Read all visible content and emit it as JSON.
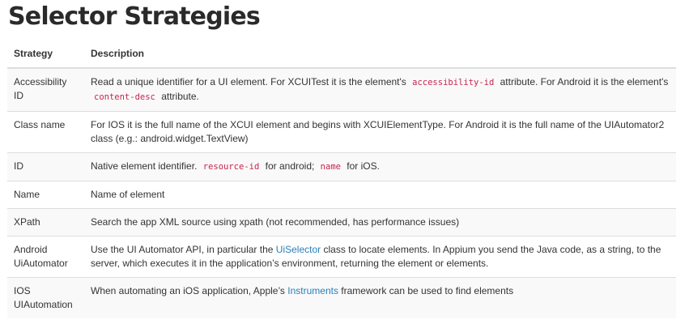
{
  "title": "Selector Strategies",
  "headers": {
    "strategy": "Strategy",
    "description": "Description"
  },
  "rows": [
    {
      "strategy": "Accessibility ID",
      "parts": [
        {
          "t": "text",
          "v": "Read a unique identifier for a UI element. For XCUITest it is the element's "
        },
        {
          "t": "code",
          "v": "accessibility-id"
        },
        {
          "t": "text",
          "v": " attribute. For Android it is the element's "
        },
        {
          "t": "code",
          "v": "content-desc"
        },
        {
          "t": "text",
          "v": " attribute."
        }
      ]
    },
    {
      "strategy": "Class name",
      "parts": [
        {
          "t": "text",
          "v": "For IOS it is the full name of the XCUI element and begins with XCUIElementType. For Android it is the full name of the UIAutomator2 class (e.g.: android.widget.TextView)"
        }
      ]
    },
    {
      "strategy": "ID",
      "parts": [
        {
          "t": "text",
          "v": "Native element identifier. "
        },
        {
          "t": "code",
          "v": "resource-id"
        },
        {
          "t": "text",
          "v": " for android; "
        },
        {
          "t": "code",
          "v": "name"
        },
        {
          "t": "text",
          "v": " for iOS."
        }
      ]
    },
    {
      "strategy": "Name",
      "parts": [
        {
          "t": "text",
          "v": "Name of element"
        }
      ]
    },
    {
      "strategy": "XPath",
      "parts": [
        {
          "t": "text",
          "v": "Search the app XML source using xpath (not recommended, has performance issues)"
        }
      ]
    },
    {
      "strategy": "Android UiAutomator",
      "parts": [
        {
          "t": "text",
          "v": "Use the UI Automator API, in particular the "
        },
        {
          "t": "link",
          "v": "UiSelector"
        },
        {
          "t": "text",
          "v": " class to locate elements. In Appium you send the Java code, as a string, to the server, which executes it in the application’s environment, returning the element or elements."
        }
      ]
    },
    {
      "strategy": "IOS UIAutomation",
      "parts": [
        {
          "t": "text",
          "v": "When automating an iOS application, Apple’s "
        },
        {
          "t": "link",
          "v": "Instruments"
        },
        {
          "t": "text",
          "v": " framework can be used to find elements"
        }
      ]
    }
  ]
}
